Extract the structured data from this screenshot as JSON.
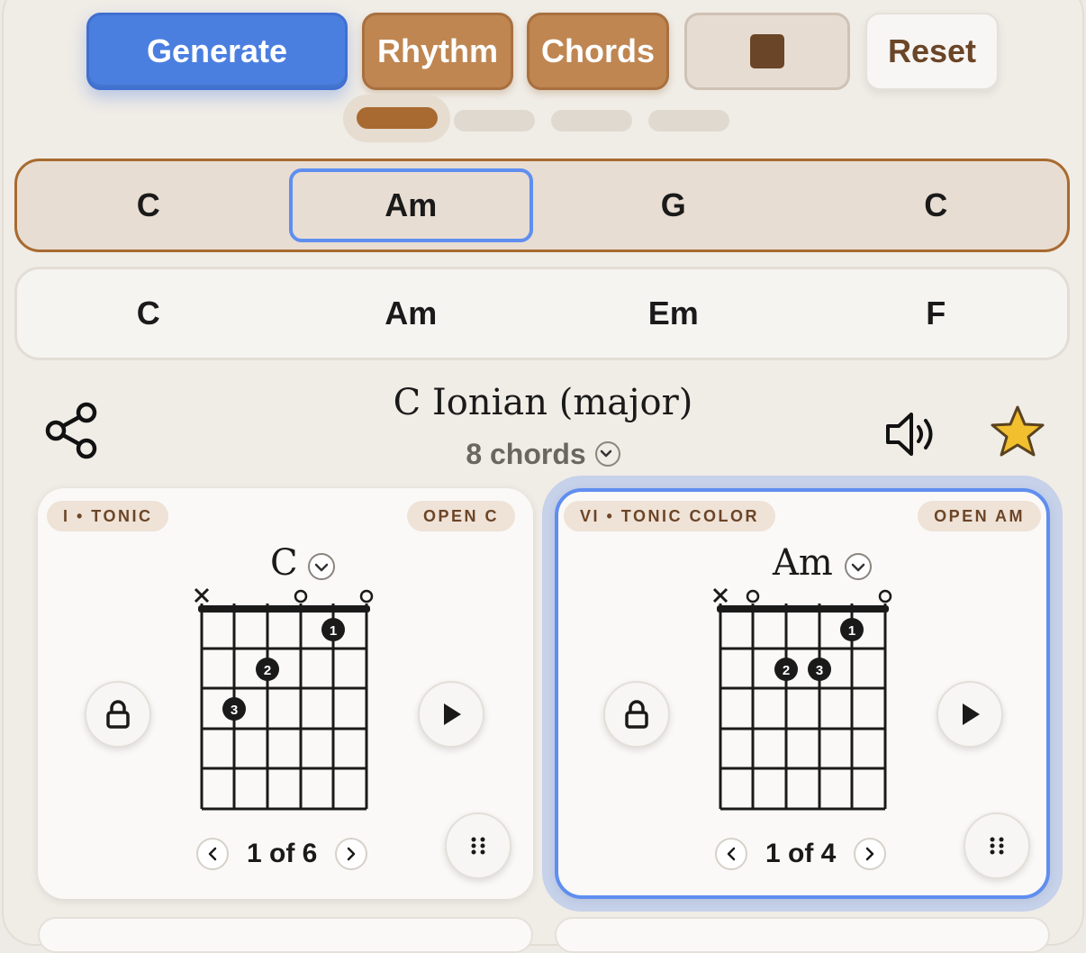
{
  "toolbar": {
    "generate_label": "Generate",
    "rhythm_label": "Rhythm",
    "chords_label": "Chords",
    "stop_icon": "stop-square-icon",
    "reset_label": "Reset",
    "page_count": 4,
    "active_page": 1
  },
  "progressions": [
    {
      "chords": [
        "C",
        "Am",
        "G",
        "C"
      ],
      "selected_index": 1,
      "active": true
    },
    {
      "chords": [
        "C",
        "Am",
        "Em",
        "F"
      ],
      "active": false
    }
  ],
  "header": {
    "title": "C Ionian (major)",
    "chord_count": "8 chords",
    "share_icon": "share-icon",
    "sound_icon": "speaker-icon",
    "favorite_icon": "star-icon"
  },
  "cards": [
    {
      "function": "I • TONIC",
      "voicing_name": "OPEN C",
      "chord": "C",
      "voicing_index": "1 of 6",
      "strings": [
        "x",
        "",
        "",
        "o",
        "",
        "o"
      ],
      "dots": [
        {
          "string": 5,
          "fret": 1,
          "finger": "1"
        },
        {
          "string": 3,
          "fret": 2,
          "finger": "2"
        },
        {
          "string": 2,
          "fret": 3,
          "finger": "3"
        }
      ],
      "selected": false
    },
    {
      "function": "VI • TONIC COLOR",
      "voicing_name": "OPEN AM",
      "chord": "Am",
      "voicing_index": "1 of 4",
      "strings": [
        "x",
        "o",
        "",
        "",
        "",
        "o"
      ],
      "dots": [
        {
          "string": 5,
          "fret": 1,
          "finger": "1"
        },
        {
          "string": 3,
          "fret": 2,
          "finger": "2"
        },
        {
          "string": 4,
          "fret": 2,
          "finger": "3"
        }
      ],
      "selected": true
    }
  ],
  "colors": {
    "accent_blue": "#4a7fe0",
    "brown": "#bf8652",
    "dark_brown": "#6b4527",
    "star": "#f2bf2e"
  }
}
